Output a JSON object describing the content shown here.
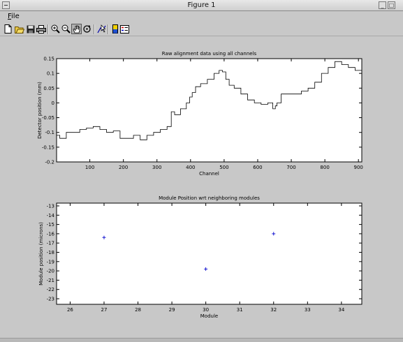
{
  "window": {
    "title": "Figure 1"
  },
  "menu": {
    "items": [
      {
        "label": "File",
        "underline": "F",
        "rest": "ile"
      }
    ]
  },
  "toolbar": {
    "icons": [
      "new-file-icon",
      "open-folder-icon",
      "save-icon",
      "print-icon",
      "zoom-in-icon",
      "zoom-out-icon",
      "pan-hand-icon",
      "rotate-icon",
      "data-cursor-icon",
      "colorbar-icon",
      "legend-icon"
    ],
    "pressed": "pan-hand-icon"
  },
  "chart_data": [
    {
      "type": "line",
      "title": "Raw alignment data using all channels",
      "xlabel": "Channel",
      "ylabel": "Detector position (mm)",
      "xlim": [
        1,
        910
      ],
      "ylim": [
        -0.2,
        0.15
      ],
      "xticks": [
        100,
        200,
        300,
        400,
        500,
        600,
        700,
        800,
        900
      ],
      "yticks": [
        -0.2,
        -0.15,
        -0.1,
        -0.05,
        0,
        0.05,
        0.1,
        0.15
      ],
      "ytick_labels": [
        "-0.2",
        "-0.15",
        "-0.1",
        "-0.05",
        "0",
        "0.05",
        "0.1",
        "0.15"
      ],
      "grid": false,
      "color": "#000000",
      "x": [
        1,
        20,
        40,
        60,
        80,
        100,
        120,
        140,
        160,
        180,
        200,
        220,
        240,
        260,
        280,
        300,
        320,
        340,
        345,
        360,
        380,
        395,
        400,
        410,
        420,
        440,
        460,
        480,
        490,
        500,
        510,
        520,
        540,
        560,
        580,
        600,
        620,
        640,
        650,
        655,
        660,
        680,
        700,
        720,
        740,
        760,
        780,
        800,
        820,
        840,
        860,
        880,
        900,
        910
      ],
      "y": [
        -0.11,
        -0.12,
        -0.1,
        -0.1,
        -0.09,
        -0.085,
        -0.08,
        -0.09,
        -0.1,
        -0.095,
        -0.12,
        -0.12,
        -0.11,
        -0.125,
        -0.11,
        -0.1,
        -0.09,
        -0.08,
        -0.03,
        -0.04,
        -0.02,
        0.0,
        0.02,
        0.035,
        0.055,
        0.065,
        0.08,
        0.1,
        0.11,
        0.105,
        0.08,
        0.06,
        0.05,
        0.03,
        0.01,
        0.0,
        -0.005,
        0.0,
        -0.02,
        -0.01,
        0.0,
        0.03,
        0.03,
        0.03,
        0.04,
        0.05,
        0.07,
        0.1,
        0.12,
        0.14,
        0.13,
        0.12,
        0.11,
        0.11
      ]
    },
    {
      "type": "scatter",
      "title": "Module Position wrt neighboring modules",
      "xlabel": "Module",
      "ylabel": "Module position (microns)",
      "xlim": [
        25.6,
        34.6
      ],
      "ylim": [
        -23.6,
        -12.7
      ],
      "xticks": [
        26,
        27,
        28,
        29,
        30,
        31,
        32,
        33,
        34
      ],
      "yticks": [
        -23,
        -22,
        -21,
        -20,
        -19,
        -18,
        -17,
        -16,
        -15,
        -14,
        -13
      ],
      "grid": false,
      "marker": "+",
      "color": "#0000cc",
      "x": [
        27,
        30,
        32
      ],
      "y": [
        -16.4,
        -19.8,
        -16.0
      ]
    }
  ]
}
